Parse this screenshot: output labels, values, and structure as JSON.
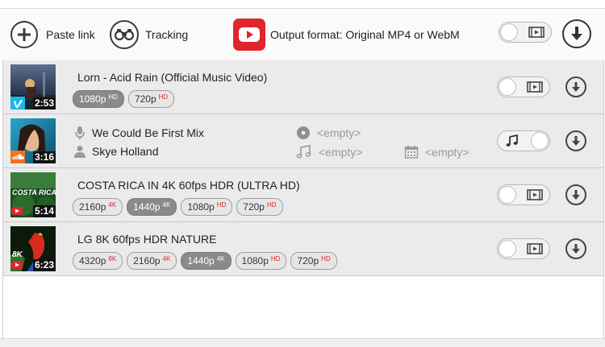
{
  "toolbar": {
    "paste_label": "Paste link",
    "tracking_label": "Tracking",
    "output_format_label": "Output format: Original MP4 or WebM"
  },
  "items": [
    {
      "title": "Lorn - Acid Rain (Official Music Video)",
      "duration": "2:53",
      "source": "vimeo",
      "qualities": [
        {
          "label": "1080p",
          "badge": "HD",
          "selected": true
        },
        {
          "label": "720p",
          "badge": "HD",
          "selected": false
        }
      ]
    },
    {
      "track": "We Could Be First Mix",
      "artist": "Skye Holland",
      "album": "<empty>",
      "genre": "<empty>",
      "date": "<empty>",
      "duration": "3:16",
      "source": "soundcloud",
      "mode": "audio"
    },
    {
      "title": "COSTA RICA IN 4K 60fps HDR (ULTRA HD)",
      "duration": "5:14",
      "source": "youtube",
      "thumb_text": "COSTA RICA",
      "qualities": [
        {
          "label": "2160p",
          "badge": "4K",
          "selected": false
        },
        {
          "label": "1440p",
          "badge": "4K",
          "selected": true
        },
        {
          "label": "1080p",
          "badge": "HD",
          "selected": false
        },
        {
          "label": "720p",
          "badge": "HD",
          "selected": false
        }
      ]
    },
    {
      "title": "LG 8K 60fps HDR NATURE",
      "duration": "6:23",
      "source": "youtube",
      "thumb_text": "8K",
      "qualities": [
        {
          "label": "4320p",
          "badge": "8K",
          "selected": false
        },
        {
          "label": "2160p",
          "badge": "4K",
          "selected": false
        },
        {
          "label": "1440p",
          "badge": "4K",
          "selected": true
        },
        {
          "label": "1080p",
          "badge": "HD",
          "selected": false
        },
        {
          "label": "720p",
          "badge": "HD",
          "selected": false
        }
      ]
    }
  ],
  "colors": {
    "accent_red": "#e0262a",
    "badge_red": "#d42a2a",
    "row_bg": "#ebebeb",
    "vimeo": "#1ab7ea",
    "soundcloud": "#f26f23"
  }
}
